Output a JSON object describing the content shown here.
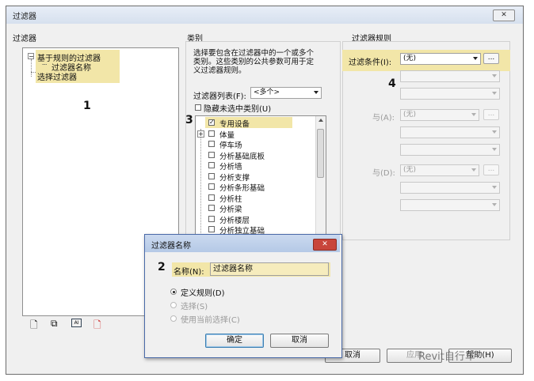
{
  "window": {
    "title": "过滤器",
    "close_label": "✕"
  },
  "filters_panel": {
    "heading": "过滤器",
    "tree": {
      "rule_based_group": "基于规则的过滤器",
      "filter_name_item": "过滤器名称",
      "selection_group": "选择过滤器"
    },
    "annotation": "1",
    "tools": [
      "new-filter-icon",
      "duplicate-icon",
      "rename-icon",
      "delete-icon"
    ]
  },
  "categories_panel": {
    "heading": "类别",
    "description_line1": "选择要包含在过滤器中的一个或多个",
    "description_line2": "类别。这些类别的公共参数可用于定",
    "description_line3": "义过滤器规则。",
    "filter_list_label": "过滤器列表(F):",
    "filter_list_value": "<多个>",
    "hide_unchecked_label": "隐藏未选中类别(U)",
    "annotation": "3",
    "items": [
      {
        "label": "专用设备",
        "checked": true
      },
      {
        "label": "体量",
        "checked": false
      },
      {
        "label": "停车场",
        "checked": false
      },
      {
        "label": "分析基础底板",
        "checked": false
      },
      {
        "label": "分析墙",
        "checked": false
      },
      {
        "label": "分析支撑",
        "checked": false
      },
      {
        "label": "分析条形基础",
        "checked": false
      },
      {
        "label": "分析柱",
        "checked": false
      },
      {
        "label": "分析梁",
        "checked": false
      },
      {
        "label": "分析楼层",
        "checked": false
      },
      {
        "label": "分析独立基础",
        "checked": false
      }
    ]
  },
  "rules_panel": {
    "heading": "过滤器规则",
    "filter_by_label": "过滤条件(I):",
    "filter_by_value": "(无)",
    "dots": "...",
    "annotation": "4",
    "and1_label": "与(A):",
    "and1_value": "(无)",
    "and2_label": "与(D):",
    "and2_value": "(无)"
  },
  "bottom_buttons": {
    "cancel": "取消",
    "apply": "应用",
    "help": "帮助(H)"
  },
  "watermark": "Revit自行车",
  "dialog": {
    "title": "过滤器名称",
    "close_label": "✕",
    "annotation": "2",
    "name_label": "名称(N):",
    "name_value": "过滤器名称",
    "option_define_rules": "定义规则(D)",
    "option_select": "选择(S)",
    "option_use_current": "使用当前选择(C)",
    "ok": "确定",
    "cancel": "取消"
  },
  "colors": {
    "highlight": "#f2e6a8",
    "dialog_title": "#b5c9e6",
    "close_red": "#c8453b"
  }
}
